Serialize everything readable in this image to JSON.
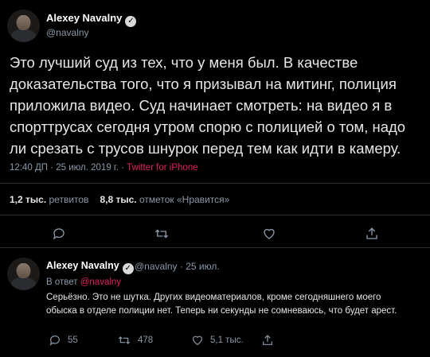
{
  "main_tweet": {
    "author_name": "Alexey Navalny",
    "author_handle": "@navalny",
    "text": "Это лучший суд из тех, что у меня был. В качестве доказательства того, что я призывал на митинг, полиция приложила видео. Суд начинает смотреть: на видео я в спорттрусах сегодня утром спорю с полицией о том, надо ли срезать с трусов шнурок перед тем как идти в камеру.",
    "timestamp": "12:40 ДП · 25 июл. 2019 г. · ",
    "source": "Twitter for iPhone",
    "retweets_count": "1,2 тыс.",
    "retweets_label": "ретвитов",
    "likes_count": "8,8 тыс.",
    "likes_label": "отметок «Нравится»"
  },
  "reply_tweet": {
    "author_name": "Alexey Navalny",
    "author_handle": "@navalny",
    "date": "· 25 июл.",
    "reply_prefix": "В ответ ",
    "reply_mention": "@navalny",
    "text": "Серьёзно. Это не шутка. Других видеоматериалов, кроме сегодняшнего моего обыска в отделе полиции нет. Теперь ни секунды не сомневаюсь, что будет арест.",
    "replies_count": "55",
    "retweets_count": "478",
    "likes_count": "5,1 тыс."
  },
  "icons": {
    "verified": "verified-badge-icon",
    "reply": "reply-icon",
    "retweet": "retweet-icon",
    "like": "like-icon",
    "share": "share-icon"
  },
  "colors": {
    "background": "#000000",
    "accent": "#e0245e",
    "secondary_text": "#8b98a5"
  }
}
